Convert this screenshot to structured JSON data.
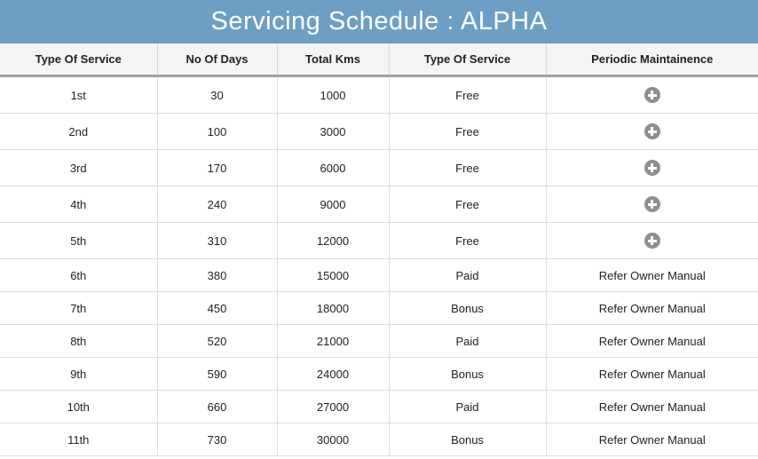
{
  "title": "Servicing Schedule : ALPHA",
  "columns": [
    "Type Of Service",
    "No Of Days",
    "Total Kms",
    "Type Of Service",
    "Periodic Maintainence"
  ],
  "rows": [
    {
      "service": "1st",
      "days": "30",
      "kms": "1000",
      "type": "Free",
      "maintenance": "",
      "maintenance_icon": "plus-circle-icon"
    },
    {
      "service": "2nd",
      "days": "100",
      "kms": "3000",
      "type": "Free",
      "maintenance": "",
      "maintenance_icon": "plus-circle-icon"
    },
    {
      "service": "3rd",
      "days": "170",
      "kms": "6000",
      "type": "Free",
      "maintenance": "",
      "maintenance_icon": "plus-circle-icon"
    },
    {
      "service": "4th",
      "days": "240",
      "kms": "9000",
      "type": "Free",
      "maintenance": "",
      "maintenance_icon": "plus-circle-icon"
    },
    {
      "service": "5th",
      "days": "310",
      "kms": "12000",
      "type": "Free",
      "maintenance": "",
      "maintenance_icon": "plus-circle-icon"
    },
    {
      "service": "6th",
      "days": "380",
      "kms": "15000",
      "type": "Paid",
      "maintenance": "Refer Owner Manual"
    },
    {
      "service": "7th",
      "days": "450",
      "kms": "18000",
      "type": "Bonus",
      "maintenance": "Refer Owner Manual"
    },
    {
      "service": "8th",
      "days": "520",
      "kms": "21000",
      "type": "Paid",
      "maintenance": "Refer Owner Manual"
    },
    {
      "service": "9th",
      "days": "590",
      "kms": "24000",
      "type": "Bonus",
      "maintenance": "Refer Owner Manual"
    },
    {
      "service": "10th",
      "days": "660",
      "kms": "27000",
      "type": "Paid",
      "maintenance": "Refer Owner Manual"
    },
    {
      "service": "11th",
      "days": "730",
      "kms": "30000",
      "type": "Bonus",
      "maintenance": "Refer Owner Manual"
    }
  ],
  "colors": {
    "title_bar": "#6d9fc4",
    "header_bg": "#f4f4f4",
    "header_border": "#a89aa2",
    "icon": "#8f8f8f"
  }
}
